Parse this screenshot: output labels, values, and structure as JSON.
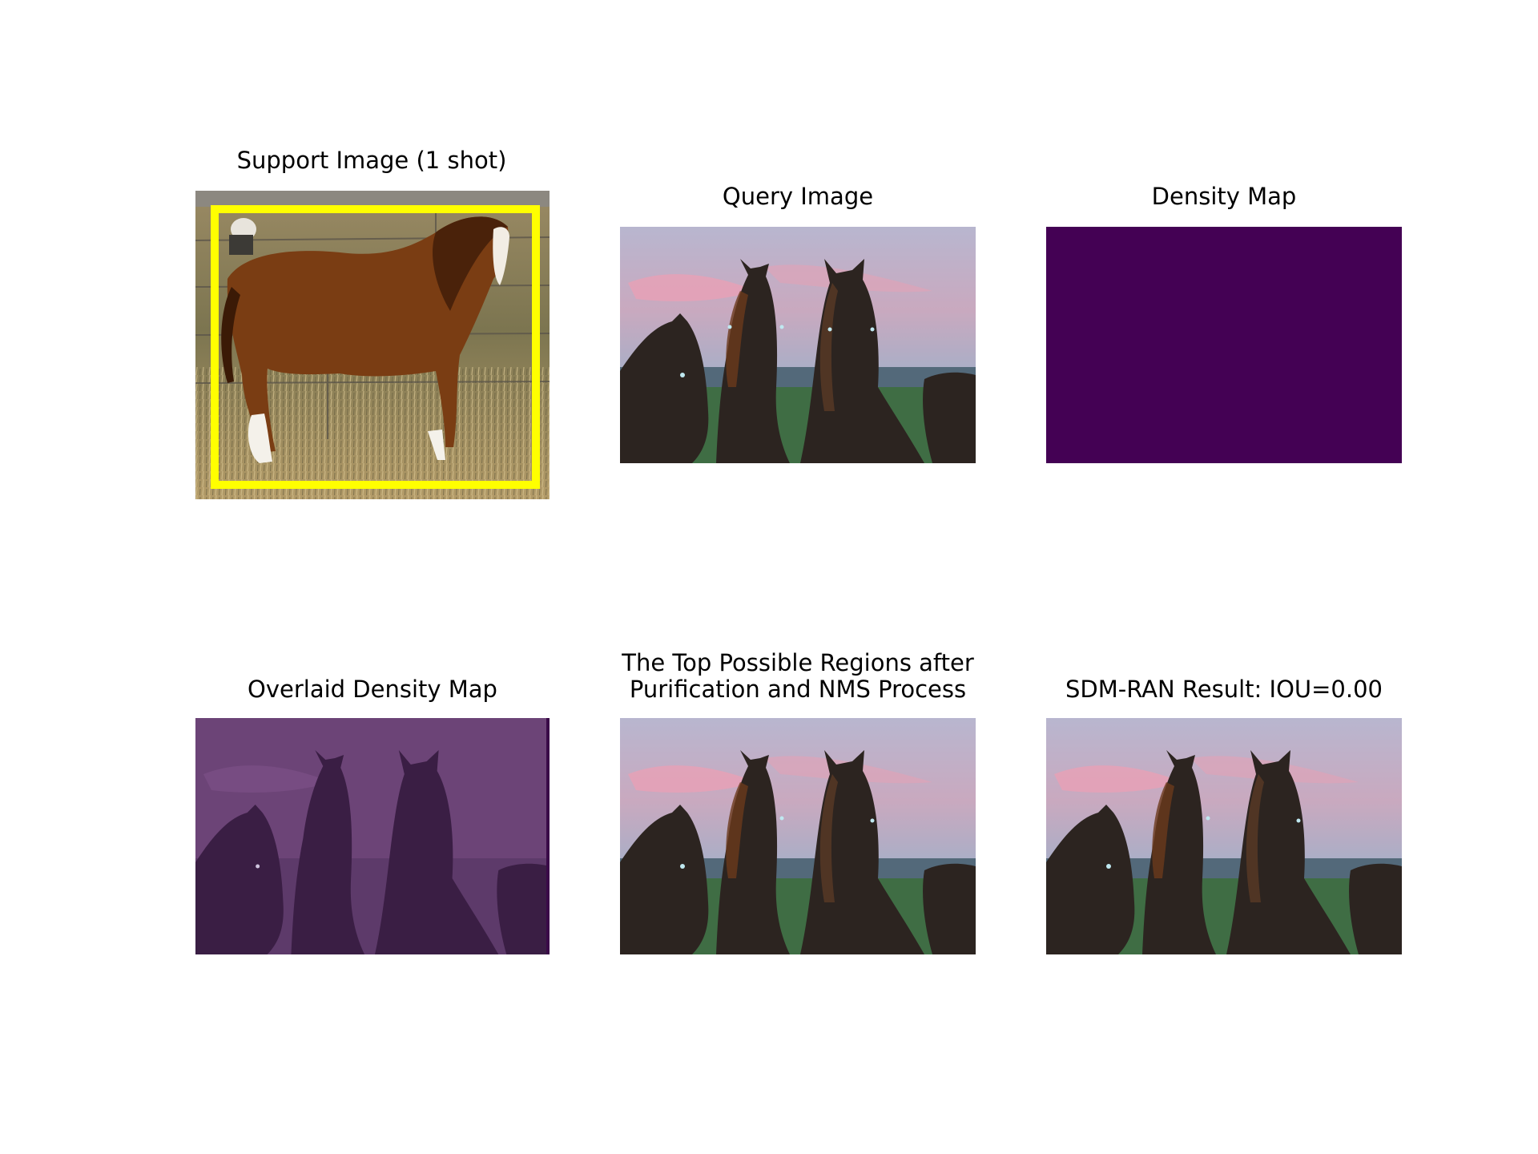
{
  "figure": {
    "panels": [
      {
        "id": "support",
        "title": "Support Image (1 shot)"
      },
      {
        "id": "query",
        "title": "Query Image"
      },
      {
        "id": "density",
        "title": "Density Map",
        "fill_color": "#440154"
      },
      {
        "id": "overlay",
        "title": "Overlaid Density Map",
        "tint_color": "#440154"
      },
      {
        "id": "regions",
        "title_lines": [
          "The Top Possible Regions after",
          "Purification and NMS Process"
        ]
      },
      {
        "id": "result",
        "title": "SDM-RAN Result: IOU=0.00"
      }
    ],
    "support_box_color": "#ffff00"
  }
}
